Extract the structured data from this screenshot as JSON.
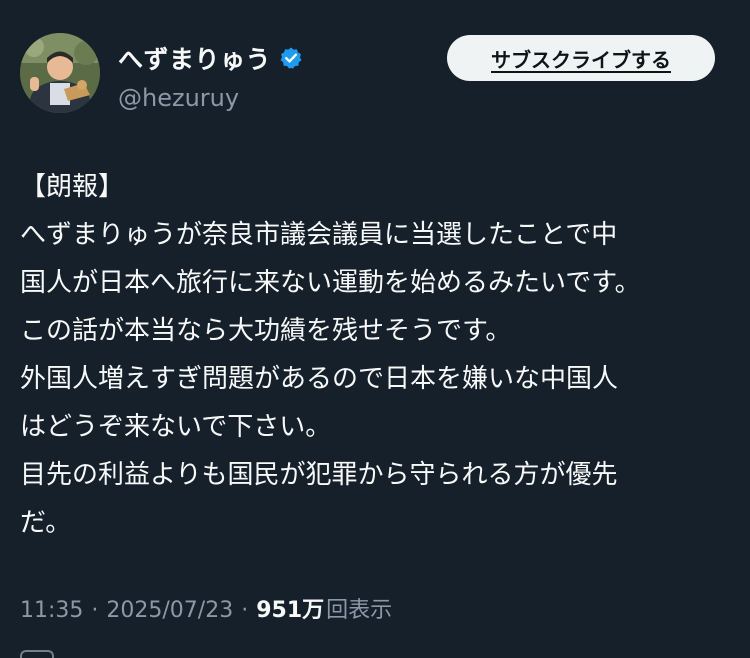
{
  "author": {
    "display_name": "へずまりゅう",
    "handle": "@hezuruy",
    "verified_icon": "verified-badge",
    "verified_color": "#1d9bf0"
  },
  "subscribe_button": {
    "label": "サブスクライブする"
  },
  "tweet": {
    "lines": [
      "【朗報】",
      "へずまりゅうが奈良市議会議員に当選したことで中",
      "国人が日本へ旅行に来ない運動を始めるみたいです。",
      "この話が本当なら大功績を残せそうです。",
      "外国人増えすぎ問題があるので日本を嫌いな中国人",
      "はどうぞ来ないで下さい。",
      "目先の利益よりも国民が犯罪から守られる方が優先",
      "だ。"
    ]
  },
  "meta": {
    "time": "11:35",
    "separator": "·",
    "date": "2025/07/23",
    "views_count": "951万",
    "views_label": "回表示"
  },
  "colors": {
    "background": "#15202b",
    "text_primary": "#f7f9f9",
    "text_secondary": "#8b98a5",
    "button_bg": "#eff3f4"
  }
}
